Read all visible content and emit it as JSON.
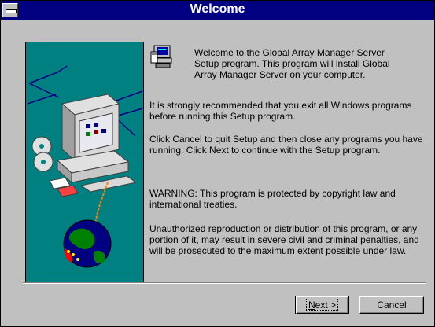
{
  "window": {
    "title": "Welcome"
  },
  "icons": {
    "system_menu": "system-menu-icon",
    "setup": "setup-computer-icon",
    "sidebar_art": "computer-globe-illustration"
  },
  "content": {
    "intro": "Welcome to the Global Array Manager Server Setup program.  This program will install Global Array Manager Server on your computer.",
    "recommend": "It is strongly recommended that you exit all Windows programs before running this Setup program.",
    "instructions": "Click Cancel to quit Setup and then close any programs you have running.  Click Next to continue with the Setup program.",
    "warning": "WARNING: This program is protected by copyright law and international treaties.",
    "penalties": "Unauthorized reproduction or distribution of this program, or any portion of it, may result in severe civil and criminal penalties, and will be prosecuted to the maximum extent possible under law."
  },
  "buttons": {
    "next_mnemonic": "N",
    "next_rest": "ext >",
    "cancel": "Cancel"
  },
  "colors": {
    "title_bar": "#000080",
    "face": "#c0c0c0",
    "art_background": "#008080"
  }
}
